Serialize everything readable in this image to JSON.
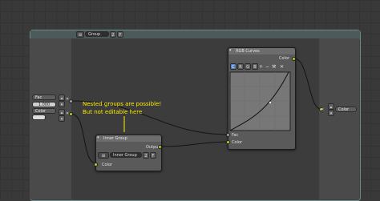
{
  "group_header": {
    "name": "Group",
    "users": "2",
    "fake_user": "F"
  },
  "group_inputs": {
    "fac_label": "Fac",
    "fac_value": "1.000",
    "color_label": "Color"
  },
  "group_outputs": {
    "color_label": "Color"
  },
  "annotation": {
    "line1": "Nested groups are possible!",
    "line2": "But not editable here"
  },
  "inner_group_node": {
    "title": "Inner Group",
    "datablock": "Inner Group",
    "users": "2",
    "fake_user": "F",
    "output_label": "Output",
    "input_label": "Color"
  },
  "rgb_curves_node": {
    "title": "RGB Curves",
    "output_label": "Color",
    "channels": [
      "C",
      "R",
      "G",
      "B"
    ],
    "tools": [
      "+",
      "−",
      "⚒",
      "✕"
    ],
    "fac_label": "Fac",
    "color_label": "Color"
  },
  "colors": {
    "socket_color": "#c7c729",
    "socket_float": "#a1a1a1",
    "annotation": "#ffeb00",
    "group_border": "#6a8a8a"
  }
}
